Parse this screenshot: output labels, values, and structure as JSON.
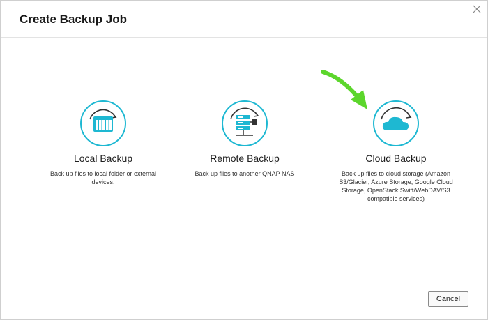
{
  "dialog": {
    "title": "Create Backup Job"
  },
  "options": [
    {
      "title": "Local Backup",
      "description": "Back up files to local folder or external devices."
    },
    {
      "title": "Remote Backup",
      "description": "Back up files to another QNAP NAS"
    },
    {
      "title": "Cloud Backup",
      "description": "Back up files to cloud storage (Amazon S3/Glacier, Azure Storage, Google Cloud Storage, OpenStack Swift/WebDAV/S3 compatible services)"
    }
  ],
  "footer": {
    "cancel_label": "Cancel"
  },
  "colors": {
    "accent": "#1eb8d2",
    "highlight_arrow": "#5cd62c"
  }
}
